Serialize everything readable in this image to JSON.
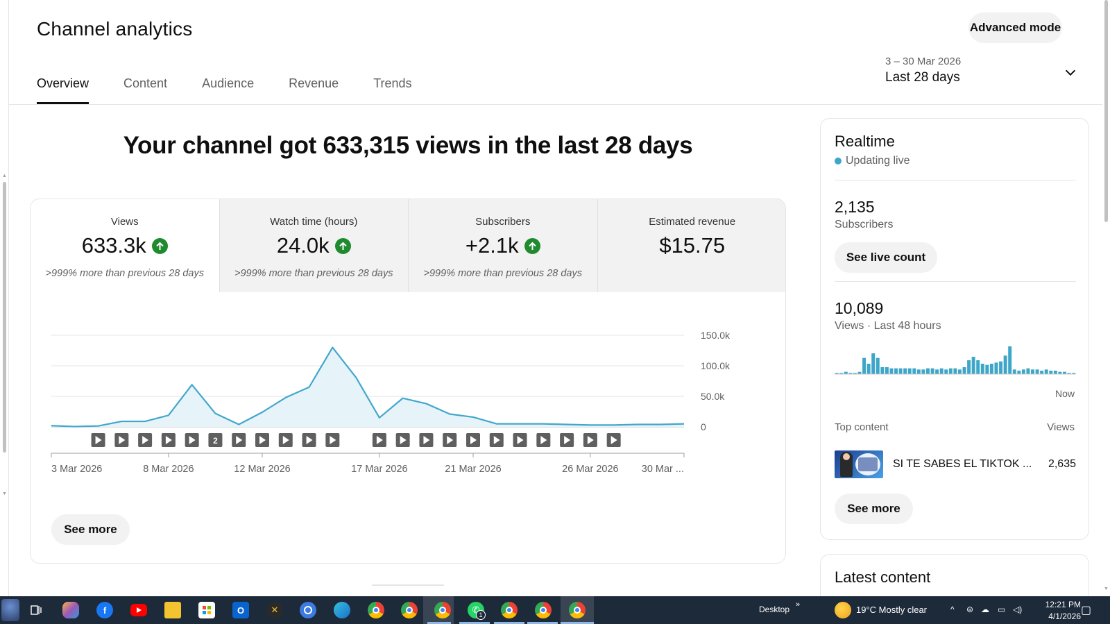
{
  "header": {
    "title": "Channel analytics",
    "advanced_mode": "Advanced mode",
    "tabs": [
      "Overview",
      "Content",
      "Audience",
      "Revenue",
      "Trends"
    ],
    "active_tab": "Overview",
    "date_range": {
      "dates": "3 – 30 Mar 2026",
      "label": "Last 28 days"
    }
  },
  "headline": "Your channel got 633,315 views in the last 28 days",
  "metrics": [
    {
      "label": "Views",
      "value": "633.3k",
      "up": true,
      "note": ">999% more than previous 28 days"
    },
    {
      "label": "Watch time (hours)",
      "value": "24.0k",
      "up": true,
      "note": ">999% more than previous 28 days"
    },
    {
      "label": "Subscribers",
      "value": "+2.1k",
      "up": true,
      "note": ">999% more than previous 28 days"
    },
    {
      "label": "Estimated revenue",
      "value": "$15.75",
      "up": false,
      "note": ""
    }
  ],
  "chart_data": {
    "type": "area",
    "series": [
      {
        "values": [
          2000,
          500,
          1500,
          9000,
          9000,
          19000,
          69000,
          22000,
          4000,
          24000,
          48000,
          65000,
          130000,
          81000,
          15000,
          47000,
          38000,
          21000,
          16000,
          5000,
          5000,
          5000,
          4000,
          3000,
          3000,
          4000,
          4000,
          5000
        ]
      }
    ],
    "x_ticks": [
      "3 Mar 2026",
      "8 Mar 2026",
      "12 Mar 2026",
      "17 Mar 2026",
      "21 Mar 2026",
      "26 Mar 2026",
      "30 Mar ..."
    ],
    "x_tick_days": [
      3,
      8,
      12,
      17,
      21,
      26,
      30
    ],
    "y_ticks": [
      "150.0k",
      "100.0k",
      "50.0k",
      "0"
    ],
    "ylim": [
      0,
      150000
    ],
    "grid": true,
    "line_color": "#41a7cc",
    "fill_color": "#e6f3f8",
    "video_markers": [
      {
        "day": 5
      },
      {
        "day": 6
      },
      {
        "day": 7
      },
      {
        "day": 8
      },
      {
        "day": 9
      },
      {
        "day": 10,
        "label": "2"
      },
      {
        "day": 11
      },
      {
        "day": 12
      },
      {
        "day": 13
      },
      {
        "day": 14
      },
      {
        "day": 15
      },
      {
        "day": 17
      },
      {
        "day": 18
      },
      {
        "day": 19
      },
      {
        "day": 20
      },
      {
        "day": 21
      },
      {
        "day": 22
      },
      {
        "day": 23
      },
      {
        "day": 24
      },
      {
        "day": 25
      },
      {
        "day": 26
      },
      {
        "day": 27
      }
    ]
  },
  "see_more": "See more",
  "realtime": {
    "title": "Realtime",
    "status": "Updating live",
    "subscribers": "2,135",
    "subscribers_label": "Subscribers",
    "live_count_btn": "See live count",
    "views": "10,089",
    "views_label": "Views · Last 48 hours",
    "now_label": "Now",
    "bars": [
      1,
      1,
      2,
      1,
      1,
      2,
      14,
      9,
      18,
      14,
      6,
      6,
      5,
      5,
      5,
      5,
      5,
      5,
      4,
      4,
      5,
      5,
      4,
      5,
      4,
      5,
      5,
      4,
      6,
      12,
      15,
      12,
      9,
      8,
      9,
      10,
      11,
      16,
      24,
      4,
      3,
      4,
      5,
      4,
      4,
      3,
      4,
      3,
      3,
      2,
      2,
      1,
      1
    ],
    "bar_color": "#3ea6c8",
    "top_content_label": "Top content",
    "top_content_views_label": "Views",
    "top_item": {
      "title": "SI TE SABES EL TIKTOK ...",
      "views": "2,635"
    },
    "see_more": "See more"
  },
  "latest": {
    "title": "Latest content"
  },
  "taskbar": {
    "apps": [
      "task-view",
      "copilot",
      "facebook",
      "youtube",
      "file-explorer",
      "microsoft-store",
      "outlook",
      "xbox",
      "cortana",
      "edge",
      "chrome",
      "chrome-profile",
      "chrome-profile",
      "whatsapp",
      "chrome-profile",
      "chrome-profile",
      "chrome-profile"
    ],
    "whatsapp_badge": "1",
    "desktop_label": "Desktop",
    "weather": "19°C  Mostly clear",
    "time": "12:21 PM",
    "date": "4/1/2026"
  }
}
